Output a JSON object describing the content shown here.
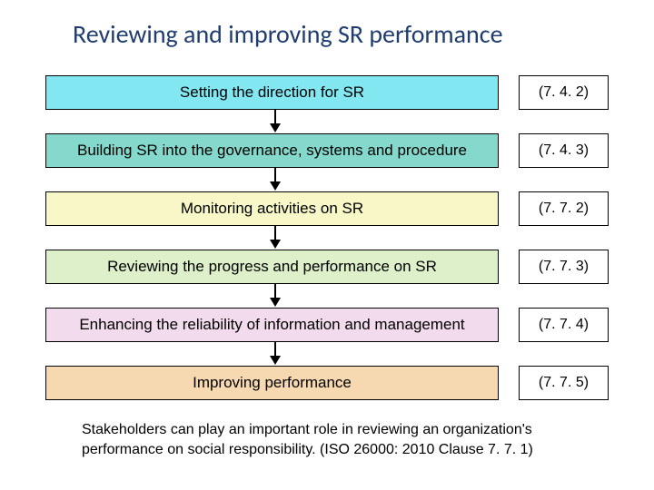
{
  "title": "Reviewing and improving SR performance",
  "steps": [
    {
      "label": "Setting the direction for SR",
      "ref": "(7. 4. 2)"
    },
    {
      "label": "Building SR into the governance, systems and procedure",
      "ref": "(7. 4. 3)"
    },
    {
      "label": "Monitoring activities on SR",
      "ref": "(7. 7. 2)"
    },
    {
      "label": "Reviewing the progress and performance on SR",
      "ref": "(7. 7. 3)"
    },
    {
      "label": "Enhancing the reliability of information and management",
      "ref": "(7. 7. 4)"
    },
    {
      "label": "Improving performance",
      "ref": "(7. 7. 5)"
    }
  ],
  "footnote": "Stakeholders can play an important role in reviewing an organization's performance on social responsibility. (ISO 26000:  2010  Clause 7. 7. 1)"
}
